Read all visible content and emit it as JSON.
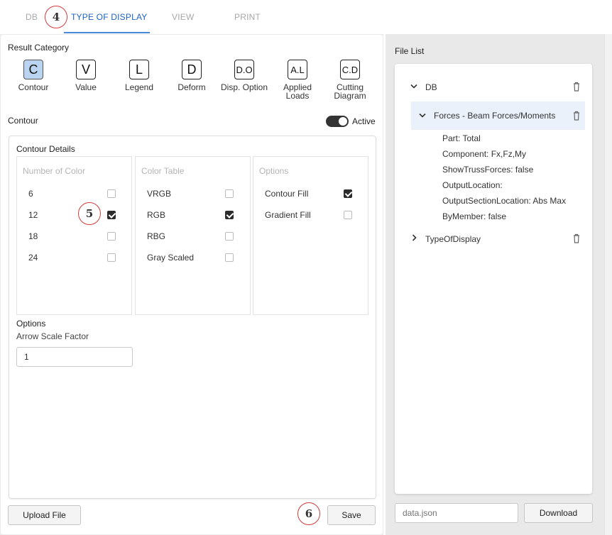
{
  "tabs": [
    {
      "label": "DB"
    },
    {
      "label": "TYPE OF DISPLAY"
    },
    {
      "label": "VIEW"
    },
    {
      "label": "PRINT"
    }
  ],
  "annotations": {
    "a4": "4",
    "a5": "5",
    "a6": "6"
  },
  "result_category": {
    "title": "Result Category",
    "items": [
      {
        "icon": "C",
        "label": "Contour",
        "selected": true
      },
      {
        "icon": "V",
        "label": "Value"
      },
      {
        "icon": "L",
        "label": "Legend"
      },
      {
        "icon": "D",
        "label": "Deform"
      },
      {
        "icon": "D.O",
        "label": "Disp. Option"
      },
      {
        "icon": "A.L",
        "label_line1": "Applied",
        "label_line2": "Loads"
      },
      {
        "icon": "C.D",
        "label_line1": "Cutting",
        "label_line2": "Diagram"
      }
    ]
  },
  "contour": {
    "title": "Contour",
    "active_label": "Active",
    "active": true,
    "details_title": "Contour Details",
    "number_of_color": {
      "title": "Number of Color",
      "rows": [
        {
          "label": "6",
          "checked": false
        },
        {
          "label": "12",
          "checked": true
        },
        {
          "label": "18",
          "checked": false
        },
        {
          "label": "24",
          "checked": false
        }
      ]
    },
    "color_table": {
      "title": "Color Table",
      "rows": [
        {
          "label": "VRGB",
          "checked": false
        },
        {
          "label": "RGB",
          "checked": true
        },
        {
          "label": "RBG",
          "checked": false
        },
        {
          "label": "Gray Scaled",
          "checked": false
        }
      ]
    },
    "options_col": {
      "title": "Options",
      "rows": [
        {
          "label": "Contour Fill",
          "checked": true
        },
        {
          "label": "Gradient Fill",
          "checked": false
        }
      ]
    },
    "options": {
      "title": "Options",
      "arrow_scale_label": "Arrow Scale Factor",
      "arrow_scale_value": "1"
    }
  },
  "buttons": {
    "upload": "Upload File",
    "save": "Save",
    "download": "Download"
  },
  "file_list": {
    "title": "File List",
    "db": "DB",
    "forces": "Forces - Beam Forces/Moments",
    "props": [
      "Part: Total",
      "Component: Fx,Fz,My",
      "ShowTrussForces: false",
      "OutputLocation:",
      "OutputSectionLocation: Abs Max",
      "ByMember: false"
    ],
    "type_of_display": "TypeOfDisplay",
    "filename_placeholder": "data.json"
  },
  "colors": {
    "accent": "#1e62c7",
    "selected_bg": "#b9d3f0",
    "annotation": "#d43a3a"
  }
}
